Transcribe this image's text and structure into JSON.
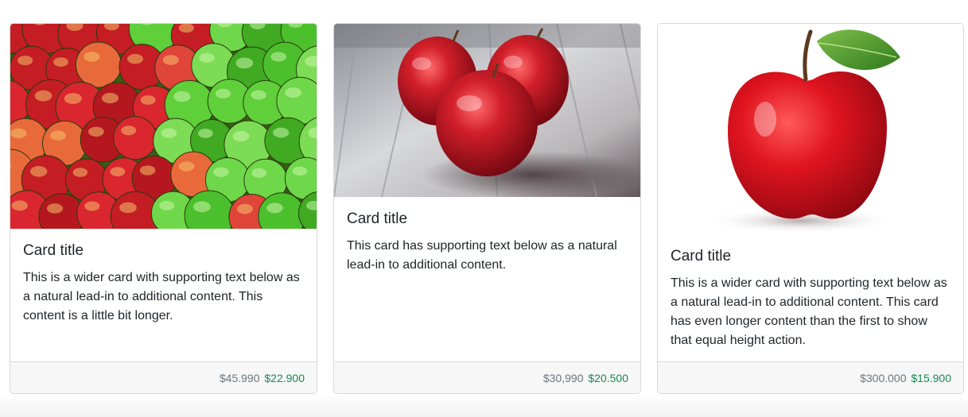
{
  "cards": [
    {
      "title": "Card title",
      "text": "This is a wider card with supporting text below as a natural lead-in to additional content. This content is a little bit longer.",
      "old_price": "$45.990",
      "new_price": "$22.900",
      "image": "pile of red and green apples"
    },
    {
      "title": "Card title",
      "text": "This card has supporting text below as a natural lead-in to additional content.",
      "old_price": "$30,990",
      "new_price": "$20.500",
      "image": "three red apples on wooden table"
    },
    {
      "title": "Card title",
      "text": "This is a wider card with supporting text below as a natural lead-in to additional content. This card has even longer content than the first to show that equal height action.",
      "old_price": "$300.000",
      "new_price": "$15.900",
      "image": "single red apple with leaf"
    }
  ],
  "colors": {
    "new_price": "#198754",
    "old_price": "#6c757d",
    "footer_bg": "#f7f7f7",
    "border": "#d9d9d9"
  }
}
